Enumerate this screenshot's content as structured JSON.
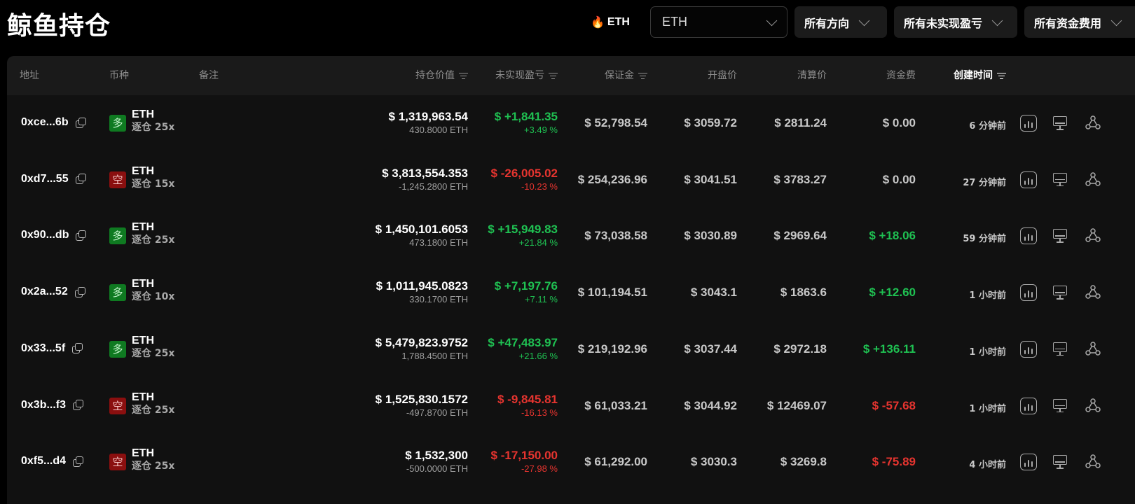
{
  "header": {
    "title": "鲸鱼持仓",
    "coin_tag": "ETH",
    "coin_select": "ETH",
    "filter_direction": "所有方向",
    "filter_pnl": "所有未实现盈亏",
    "filter_funding": "所有资金费用"
  },
  "columns": {
    "address": "地址",
    "coin": "币种",
    "note": "备注",
    "position_value": "持仓价值",
    "unrealized_pnl": "未实现盈亏",
    "margin": "保证金",
    "entry_price": "开盘价",
    "liq_price": "清算价",
    "funding": "资金费",
    "created_time": "创建时间"
  },
  "rows": [
    {
      "address": "0xce...6b",
      "side": "多",
      "side_type": "long",
      "coin": "ETH",
      "mode": "逐仓 25x",
      "value": "$ 1,319,963.54",
      "size": "430.8000 ETH",
      "pnl": "$ +1,841.35",
      "pnl_pct": "+3.49 %",
      "pnl_sign": "pos",
      "margin": "$ 52,798.54",
      "entry": "$ 3059.72",
      "liq": "$ 2811.24",
      "funding": "$ 0.00",
      "funding_sign": "zero",
      "time": "6 分钟前"
    },
    {
      "address": "0xd7...55",
      "side": "空",
      "side_type": "short",
      "coin": "ETH",
      "mode": "逐仓 15x",
      "value": "$ 3,813,554.353",
      "size": "-1,245.2800 ETH",
      "pnl": "$ -26,005.02",
      "pnl_pct": "-10.23 %",
      "pnl_sign": "neg",
      "margin": "$ 254,236.96",
      "entry": "$ 3041.51",
      "liq": "$ 3783.27",
      "funding": "$ 0.00",
      "funding_sign": "zero",
      "time": "27 分钟前"
    },
    {
      "address": "0x90...db",
      "side": "多",
      "side_type": "long",
      "coin": "ETH",
      "mode": "逐仓 25x",
      "value": "$ 1,450,101.6053",
      "size": "473.1800 ETH",
      "pnl": "$ +15,949.83",
      "pnl_pct": "+21.84 %",
      "pnl_sign": "pos",
      "margin": "$ 73,038.58",
      "entry": "$ 3030.89",
      "liq": "$ 2969.64",
      "funding": "$ +18.06",
      "funding_sign": "pos",
      "time": "59 分钟前"
    },
    {
      "address": "0x2a...52",
      "side": "多",
      "side_type": "long",
      "coin": "ETH",
      "mode": "逐仓 10x",
      "value": "$ 1,011,945.0823",
      "size": "330.1700 ETH",
      "pnl": "$ +7,197.76",
      "pnl_pct": "+7.11 %",
      "pnl_sign": "pos",
      "margin": "$ 101,194.51",
      "entry": "$ 3043.1",
      "liq": "$ 1863.6",
      "funding": "$ +12.60",
      "funding_sign": "pos",
      "time": "1 小时前"
    },
    {
      "address": "0x33...5f",
      "side": "多",
      "side_type": "long",
      "coin": "ETH",
      "mode": "逐仓 25x",
      "value": "$ 5,479,823.9752",
      "size": "1,788.4500 ETH",
      "pnl": "$ +47,483.97",
      "pnl_pct": "+21.66 %",
      "pnl_sign": "pos",
      "margin": "$ 219,192.96",
      "entry": "$ 3037.44",
      "liq": "$ 2972.18",
      "funding": "$ +136.11",
      "funding_sign": "pos",
      "time": "1 小时前"
    },
    {
      "address": "0x3b...f3",
      "side": "空",
      "side_type": "short",
      "coin": "ETH",
      "mode": "逐仓 25x",
      "value": "$ 1,525,830.1572",
      "size": "-497.8700 ETH",
      "pnl": "$ -9,845.81",
      "pnl_pct": "-16.13 %",
      "pnl_sign": "neg",
      "margin": "$ 61,033.21",
      "entry": "$ 3044.92",
      "liq": "$ 12469.07",
      "funding": "$ -57.68",
      "funding_sign": "neg",
      "time": "1 小时前"
    },
    {
      "address": "0xf5...d4",
      "side": "空",
      "side_type": "short",
      "coin": "ETH",
      "mode": "逐仓 25x",
      "value": "$ 1,532,300",
      "size": "-500.0000 ETH",
      "pnl": "$ -17,150.00",
      "pnl_pct": "-27.98 %",
      "pnl_sign": "neg",
      "margin": "$ 61,292.00",
      "entry": "$ 3030.3",
      "liq": "$ 3269.8",
      "funding": "$ -75.89",
      "funding_sign": "neg",
      "time": "4 小时前"
    }
  ],
  "colors": {
    "positive": "#1fc152",
    "negative": "#e5342f",
    "long_badge": "#0f7a21",
    "short_badge": "#8a0f0f"
  },
  "icons": [
    "flame-icon",
    "chevron-down-icon",
    "filter-icon",
    "copy-icon",
    "chart-icon",
    "monitor-icon",
    "share-icon"
  ]
}
